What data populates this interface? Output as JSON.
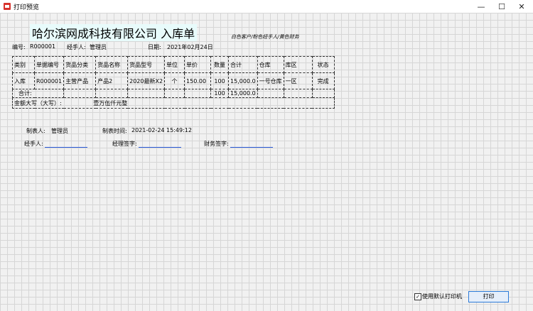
{
  "window": {
    "title": "打印预览",
    "minimize": "—",
    "maximize": "☐",
    "close": "✕"
  },
  "doc": {
    "title": "哈尔滨网成科技有限公司 入库单",
    "note": "白色客户/粉色经手人/黄色财务",
    "serial_label": "编号:",
    "serial_value": "R000001",
    "handler_label": "经手人:",
    "handler_value": "管理员",
    "date_label": "日期:",
    "date_value": "2021年02月24日"
  },
  "table": {
    "headers": [
      "类别",
      "单据编号",
      "货品分类",
      "货品名称",
      "货品型号",
      "单位",
      "单价",
      "数量",
      "合计",
      "仓库",
      "库区",
      "状态"
    ],
    "row": [
      "入库",
      "R000001",
      "主营产品",
      "产品2",
      "2020最新X2",
      "个",
      "150.00",
      "100",
      "15,000.0",
      "一号仓库",
      "一区",
      "完成"
    ],
    "total_label": "合计:",
    "total_qty": "100",
    "total_sum": "15,000.0",
    "amount_label": "金额大写（大写）:",
    "amount_value": "壹万伍仟元整"
  },
  "footer": {
    "maker_label": "制表人:",
    "maker_value": "管理员",
    "time_label": "制表时间:",
    "time_value": "2021-02-24 15:49:12",
    "handler_sig": "经手人:",
    "manager_sig": "经理签字:",
    "finance_sig": "财务签字:"
  },
  "controls": {
    "default_printer_label": "使用默认打印机",
    "default_printer_checked": "✓",
    "print_button": "打印"
  }
}
